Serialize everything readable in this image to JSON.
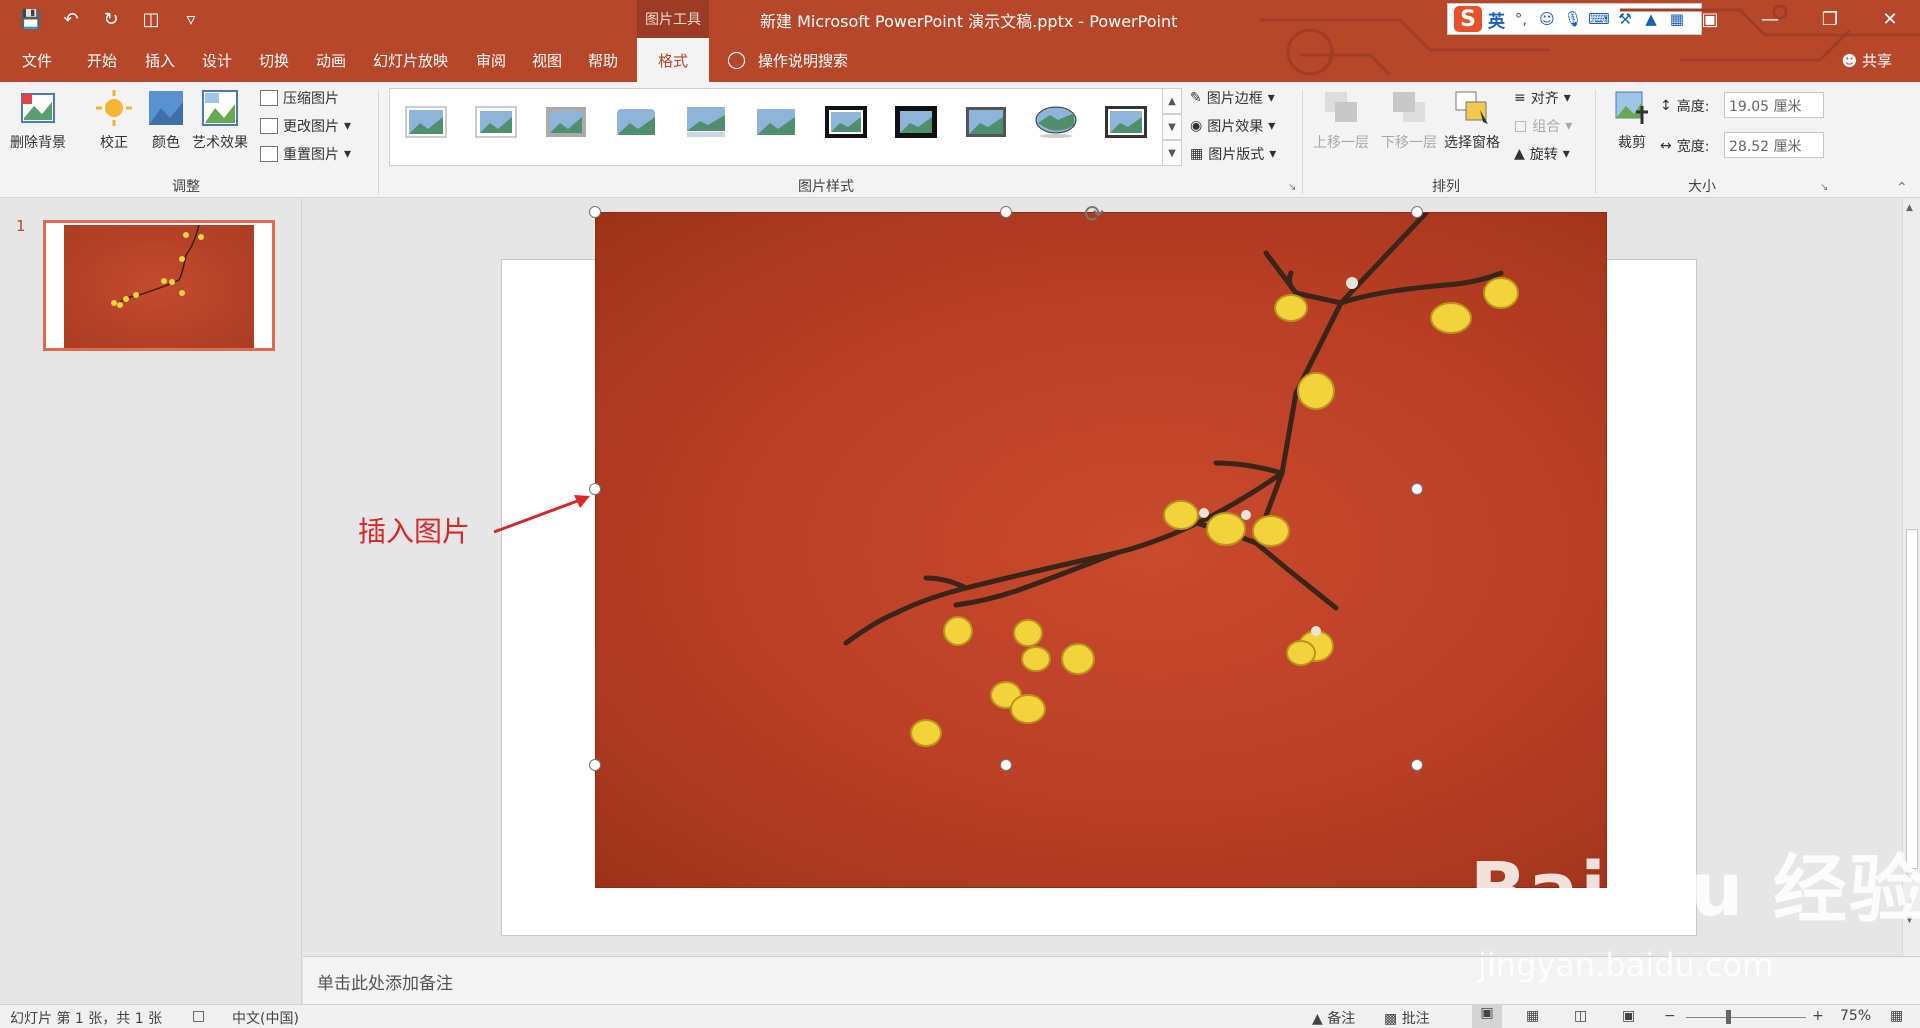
{
  "titlebar": {
    "context_label": "图片工具",
    "title": "新建 Microsoft PowerPoint 演示文稿.pptx  -  PowerPoint",
    "ime_lang": "英",
    "ime_punct": "°,"
  },
  "tabs": [
    "文件",
    "开始",
    "插入",
    "设计",
    "切换",
    "动画",
    "幻灯片放映",
    "审阅",
    "视图",
    "帮助",
    "格式"
  ],
  "active_tab": "格式",
  "tell_me": "操作说明搜索",
  "share": "共享",
  "ribbon": {
    "adjust": {
      "label": "调整",
      "remove_bg": "删除背景",
      "correct": "校正",
      "color": "颜色",
      "artistic": "艺术效果",
      "compress": "压缩图片",
      "change": "更改图片",
      "reset": "重置图片"
    },
    "styles": {
      "label": "图片样式",
      "border": "图片边框",
      "effects": "图片效果",
      "layout": "图片版式"
    },
    "arrange": {
      "label": "排列",
      "bring_forward": "上移一层",
      "send_backward": "下移一层",
      "selection_pane": "选择窗格",
      "align": "对齐",
      "group": "组合",
      "rotate": "旋转"
    },
    "size": {
      "label": "大小",
      "crop": "裁剪",
      "height_label": "高度:",
      "height_value": "19.05 厘米",
      "width_label": "宽度:",
      "width_value": "28.52 厘米"
    }
  },
  "slides": {
    "number": "1"
  },
  "annotation": "插入图片",
  "notes_placeholder": "单击此处添加备注",
  "status": {
    "slide_info": "幻灯片 第 1 张，共 1 张",
    "language": "中文(中国)",
    "notes": "备注",
    "comments": "批注",
    "zoom": "75%"
  },
  "watermark": {
    "brand": "Bai du 经验",
    "url": "jingyan.baidu.com"
  },
  "colors": {
    "accent": "#b7472a",
    "slide_photo": "#b93f26",
    "annotation": "#d9282a"
  }
}
